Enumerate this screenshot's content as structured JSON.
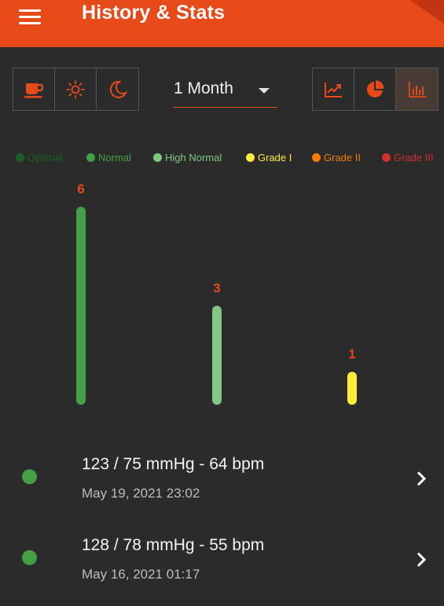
{
  "app": {
    "title": "History & Stats"
  },
  "time_of_day_filters": [
    {
      "icon": "coffee-cup-icon",
      "label": "Morning"
    },
    {
      "icon": "sun-icon",
      "label": "Day"
    },
    {
      "icon": "moon-icon",
      "label": "Night"
    }
  ],
  "period": {
    "selected": "1 Month"
  },
  "view_modes": [
    {
      "icon": "line-chart-icon",
      "active": false
    },
    {
      "icon": "pie-chart-icon",
      "active": false
    },
    {
      "icon": "bar-chart-icon",
      "active": true
    }
  ],
  "legend": [
    {
      "label": "Optimal",
      "color": "#1b5e20"
    },
    {
      "label": "Normal",
      "color": "#43a047"
    },
    {
      "label": "High Normal",
      "color": "#81c784"
    },
    {
      "label": "Grade I",
      "color": "#ffeb3b"
    },
    {
      "label": "Grade II",
      "color": "#f57c00"
    },
    {
      "label": "Grade III",
      "color": "#d32f2f"
    }
  ],
  "chart_data": {
    "type": "bar",
    "categories": [
      "Normal",
      "High Normal",
      "Grade I"
    ],
    "values": [
      6,
      3,
      1
    ],
    "colors": [
      "#43a047",
      "#81c784",
      "#ffeb3b"
    ],
    "label_color": "#e64a19",
    "ylim": [
      0,
      6
    ],
    "grid": false,
    "legend_position": "top"
  },
  "readings": [
    {
      "value": "123 / 75 mmHg - 64 bpm",
      "date": "May 19, 2021 23:02",
      "status_color": "#43a047"
    },
    {
      "value": "128 / 78 mmHg - 55 bpm",
      "date": "May 16, 2021 01:17",
      "status_color": "#43a047"
    }
  ],
  "colors": {
    "accent": "#e64a19",
    "background": "#2b2b2b"
  }
}
